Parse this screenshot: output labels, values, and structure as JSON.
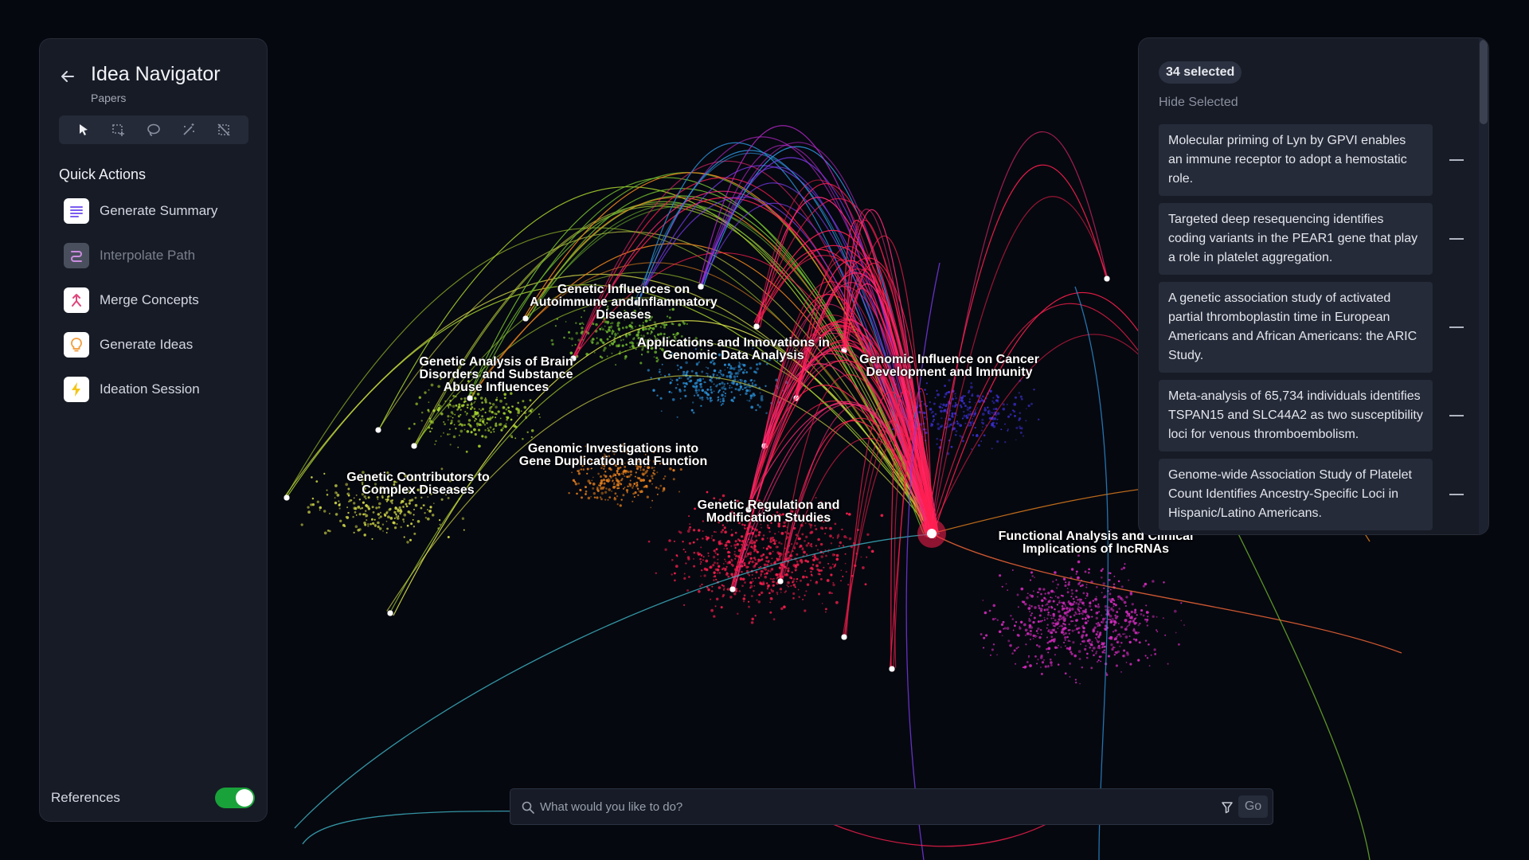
{
  "app": {
    "title": "Idea Navigator",
    "subtitle": "Papers"
  },
  "toolbar": {
    "tools": [
      {
        "name": "pointer-tool",
        "icon": "cursor-arrow-icon"
      },
      {
        "name": "box-select-tool",
        "icon": "box-select-icon"
      },
      {
        "name": "lasso-tool",
        "icon": "lasso-icon"
      },
      {
        "name": "magic-select-tool",
        "icon": "magic-wand-icon"
      },
      {
        "name": "clear-selection-tool",
        "icon": "deselect-icon"
      }
    ]
  },
  "quick_actions": {
    "title": "Quick Actions",
    "items": [
      {
        "label": "Generate Summary",
        "icon": "summary-lines-icon",
        "color": "#7b5cf0",
        "enabled": true
      },
      {
        "label": "Interpolate Path",
        "icon": "path-curve-icon",
        "color": "#b06fc7",
        "enabled": false
      },
      {
        "label": "Merge Concepts",
        "icon": "merge-arrow-icon",
        "color": "#e0457b",
        "enabled": true
      },
      {
        "label": "Generate Ideas",
        "icon": "lightbulb-icon",
        "color": "#f29b38",
        "enabled": true
      },
      {
        "label": "Ideation Session",
        "icon": "lightning-bolt-icon",
        "color": "#f5c518",
        "enabled": true
      }
    ]
  },
  "references": {
    "label": "References",
    "enabled": true,
    "accent": "#19a23a"
  },
  "selection": {
    "count_label": "34 selected",
    "hide_label": "Hide Selected",
    "papers": [
      "Molecular priming of Lyn by GPVI enables an immune receptor to adopt a hemostatic role.",
      "Targeted deep resequencing identifies coding variants in the PEAR1 gene that play a role in platelet aggregation.",
      "A genetic association study of activated partial thromboplastin time in European Americans and African Americans: the ARIC Study.",
      "Meta-analysis of 65,734 individuals identifies TSPAN15 and SLC44A2 as two susceptibility loci for venous thromboembolism.",
      "Genome-wide Association Study of Platelet Count Identifies Ancestry-Specific Loci in Hispanic/Latino Americans."
    ]
  },
  "search": {
    "placeholder": "What would you like to do?",
    "value": "",
    "go_label": "Go"
  },
  "map": {
    "clusters": [
      {
        "label": "Genetic Influences on\nAutoimmune and Inflammatory\nDiseases",
        "color": "#6fb82e"
      },
      {
        "label": "Applications and Innovations in\nGenomic Data Analysis",
        "color": "#2a8fd6"
      },
      {
        "label": "Genomic Influence on Cancer\nDevelopment and Immunity",
        "color": "#3a2fd0"
      },
      {
        "label": "Genetic Analysis of Brain\nDisorders and Substance\nAbuse Influences",
        "color": "#a6d22e"
      },
      {
        "label": "Genomic Investigations into\nGene Duplication and Function",
        "color": "#e8821e"
      },
      {
        "label": "Genetic Contributors to\nComplex Diseases",
        "color": "#d8e04a"
      },
      {
        "label": "Genetic Regulation and\nModification Studies",
        "color": "#ff1f4f"
      },
      {
        "label": "Functional Analysis and Clinical\nImplications of lncRNAs",
        "color": "#d42bbf"
      }
    ],
    "hub_color": "#ff1f4f"
  }
}
